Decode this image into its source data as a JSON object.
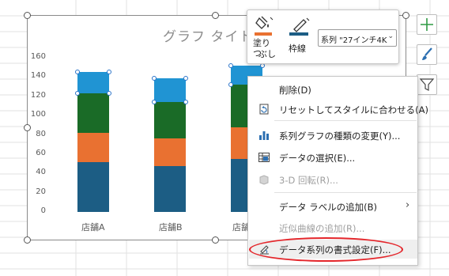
{
  "chart": {
    "title": "グラフ タイトル",
    "y_ticks": [
      "160",
      "140",
      "120",
      "100",
      "80",
      "60",
      "40",
      "20",
      "0"
    ],
    "categories": [
      "店舗A",
      "店舗B",
      "店舗"
    ]
  },
  "chart_data": {
    "type": "bar",
    "stacked": true,
    "title": "グラフ タイトル",
    "categories": [
      "店舗A",
      "店舗B",
      "店舗C"
    ],
    "series": [
      {
        "values": [
          52,
          48,
          55
        ],
        "color": "#1c5d84"
      },
      {
        "values": [
          30,
          28,
          33
        ],
        "color": "#e97131"
      },
      {
        "values": [
          41,
          38,
          44
        ],
        "color": "#1a6b27"
      },
      {
        "values": [
          22,
          25,
          20
        ],
        "color": "#2094d3"
      }
    ],
    "ylim": [
      0,
      160
    ]
  },
  "mini_toolbar": {
    "fill_label_1": "塗りつ",
    "fill_label_2": "ぶし",
    "outline_label": "枠線",
    "series_value": "系列 \"27インチ4K"
  },
  "menu": {
    "items": [
      {
        "label": "削除(D)",
        "icon": "none"
      },
      {
        "label": "リセットしてスタイルに合わせる(A)",
        "icon": "reset-style-icon"
      },
      {
        "label": "系列グラフの種類の変更(Y)...",
        "icon": "chart-type-icon"
      },
      {
        "label": "データの選択(E)...",
        "icon": "data-table-icon"
      },
      {
        "label": "3-D 回転(R)...",
        "icon": "cube-icon"
      },
      {
        "label": "データ ラベルの追加(B)",
        "icon": "none"
      },
      {
        "label": "近似曲線の追加(R)...",
        "icon": "none"
      },
      {
        "label": "データ系列の書式設定(F)...",
        "icon": "format-icon"
      }
    ]
  },
  "colors": {
    "series_dark_blue": "#1c5d84",
    "series_orange": "#e97131",
    "series_green": "#1a6b27",
    "series_light_blue": "#2094d3",
    "highlight_red": "#e4262b"
  }
}
